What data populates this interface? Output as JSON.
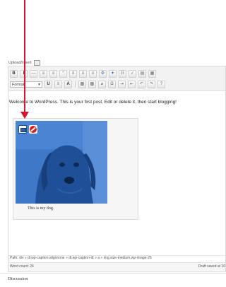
{
  "upload": {
    "label": "Upload/Insert"
  },
  "toolbar": {
    "row1": [
      "B",
      "I",
      "—",
      "≡",
      "≡",
      "“",
      "≡",
      "≡",
      "≡",
      "⚙",
      "✦",
      "☷",
      "✓",
      "▤",
      "▦"
    ],
    "format_label": "Format",
    "row2": [
      "U",
      "≡",
      "A",
      "▩",
      "▩",
      "⌀",
      "Ω",
      "⇥",
      "⇤",
      "↶",
      "↷",
      "?"
    ]
  },
  "editor": {
    "body_text": "Welcome to WordPress. This is your first post. Edit or delete it, then start blogging!",
    "caption": "This is my dog.",
    "image_tint": "#3f78c6"
  },
  "status": {
    "path": "Path: div » dl.wp-caption.alignnone » dt.wp-caption-dt » a » img.size-medium.wp-image-26",
    "word_count": "Word count: 24",
    "draft_saved": "Draft saved at 10"
  },
  "discussion": {
    "label": "Discussion"
  },
  "annotation": {
    "arrow_color": "#d6142c"
  }
}
